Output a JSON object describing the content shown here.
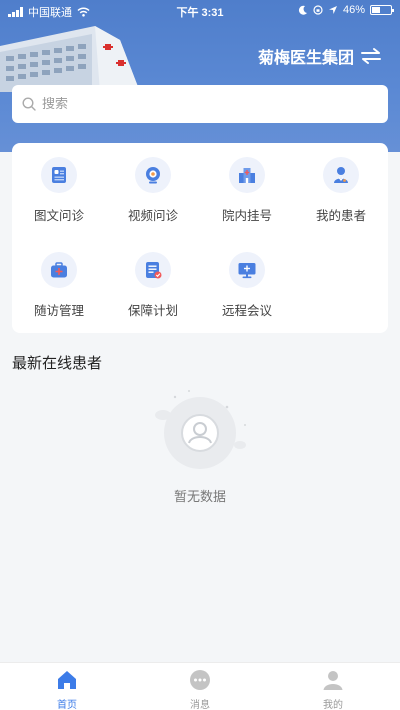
{
  "status_bar": {
    "carrier": "中国联通",
    "time": "下午 3:31",
    "battery": "46%",
    "battery_level": 0.46
  },
  "header": {
    "org_name": "菊梅医生集团",
    "switch_icon": "swap-arrows-icon"
  },
  "search": {
    "placeholder": "搜索",
    "icon": "search-icon"
  },
  "menu": {
    "items": [
      {
        "label": "图文问诊",
        "icon": "image-text-consult-icon"
      },
      {
        "label": "视频问诊",
        "icon": "video-consult-icon"
      },
      {
        "label": "院内挂号",
        "icon": "hospital-register-icon"
      },
      {
        "label": "我的患者",
        "icon": "my-patients-icon"
      },
      {
        "label": "随访管理",
        "icon": "followup-kit-icon"
      },
      {
        "label": "保障计划",
        "icon": "protection-plan-icon"
      },
      {
        "label": "远程会议",
        "icon": "remote-meeting-icon"
      }
    ]
  },
  "section": {
    "title": "最新在线患者"
  },
  "empty_state": {
    "text": "暂无数据",
    "icon": "empty-avatar-icon"
  },
  "tabbar": {
    "items": [
      {
        "label": "首页",
        "icon": "home-icon",
        "active": true
      },
      {
        "label": "消息",
        "icon": "message-icon",
        "active": false
      },
      {
        "label": "我的",
        "icon": "profile-icon",
        "active": false
      }
    ]
  },
  "colors": {
    "header_blue": "#5b89d4",
    "accent": "#3d7ce8",
    "icon_bg": "#eef2fb",
    "page_bg": "#f4f6f8"
  }
}
